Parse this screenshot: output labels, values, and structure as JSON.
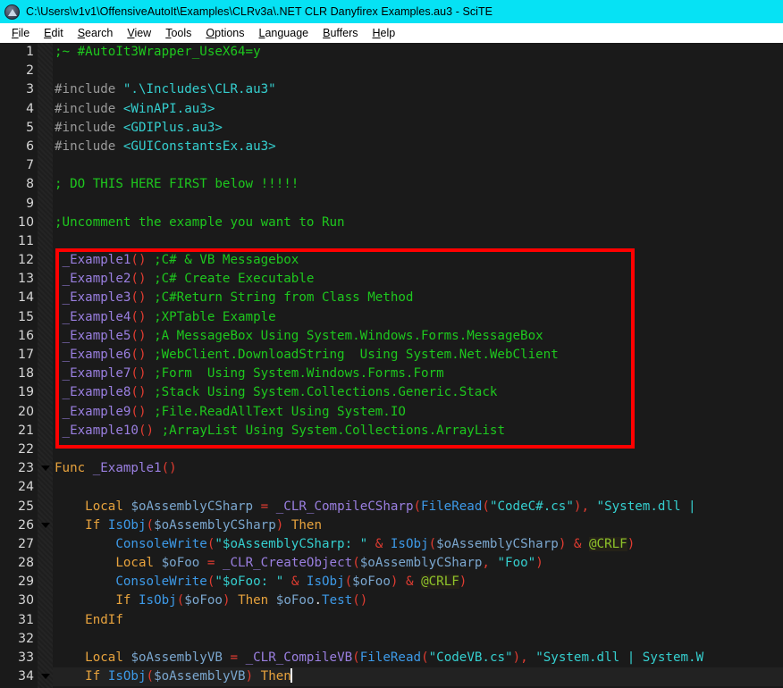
{
  "window": {
    "title": "C:\\Users\\v1v1\\OffensiveAutoIt\\Examples\\CLRv3a\\.NET CLR Danyfirex Examples.au3 - SciTE",
    "icon": "autoit-logo-icon",
    "titlebar_color": "#06e2f4",
    "menubar_color": "#ffffff"
  },
  "menu": {
    "items": [
      {
        "label": "File",
        "accel": "F"
      },
      {
        "label": "Edit",
        "accel": "E"
      },
      {
        "label": "Search",
        "accel": "S"
      },
      {
        "label": "View",
        "accel": "V"
      },
      {
        "label": "Tools",
        "accel": "T"
      },
      {
        "label": "Options",
        "accel": "O"
      },
      {
        "label": "Language",
        "accel": "L"
      },
      {
        "label": "Buffers",
        "accel": "B"
      },
      {
        "label": "Help",
        "accel": "H"
      }
    ]
  },
  "editor": {
    "background": "#1a1a1a",
    "first_line": 1,
    "last_line": 34,
    "current_line": 34,
    "caret_line": 34,
    "caret_column_text": "Then",
    "fold_lines": [
      23,
      26,
      34
    ],
    "annotation": {
      "type": "red-rectangle",
      "color": "#ff0000",
      "covers_lines": [
        12,
        21
      ]
    },
    "lines": [
      {
        "n": 1,
        "text": ";~ #AutoIt3Wrapper_UseX64=y"
      },
      {
        "n": 2,
        "text": ""
      },
      {
        "n": 3,
        "text": "#include \".\\Includes\\CLR.au3\""
      },
      {
        "n": 4,
        "text": "#include <WinAPI.au3>"
      },
      {
        "n": 5,
        "text": "#include <GDIPlus.au3>"
      },
      {
        "n": 6,
        "text": "#include <GUIConstantsEx.au3>"
      },
      {
        "n": 7,
        "text": ""
      },
      {
        "n": 8,
        "text": "; DO THIS HERE FIRST below !!!!!"
      },
      {
        "n": 9,
        "text": ""
      },
      {
        "n": 10,
        "text": ";Uncomment the example you want to Run"
      },
      {
        "n": 11,
        "text": ""
      },
      {
        "n": 12,
        "text": " _Example1() ;C# & VB Messagebox"
      },
      {
        "n": 13,
        "text": " _Example2() ;C# Create Executable"
      },
      {
        "n": 14,
        "text": " _Example3() ;C#Return String from Class Method"
      },
      {
        "n": 15,
        "text": " _Example4() ;XPTable Example"
      },
      {
        "n": 16,
        "text": " _Example5() ;A MessageBox Using System.Windows.Forms.MessageBox"
      },
      {
        "n": 17,
        "text": " _Example6() ;WebClient.DownloadString  Using System.Net.WebClient"
      },
      {
        "n": 18,
        "text": " _Example7() ;Form  Using System.Windows.Forms.Form"
      },
      {
        "n": 19,
        "text": " _Example8() ;Stack Using System.Collections.Generic.Stack"
      },
      {
        "n": 20,
        "text": " _Example9() ;File.ReadAllText Using System.IO"
      },
      {
        "n": 21,
        "text": " _Example10() ;ArrayList Using System.Collections.ArrayList"
      },
      {
        "n": 22,
        "text": ""
      },
      {
        "n": 23,
        "text": "Func _Example1()"
      },
      {
        "n": 24,
        "text": ""
      },
      {
        "n": 25,
        "text": "    Local $oAssemblyCSharp = _CLR_CompileCSharp(FileRead(\"CodeC#.cs\"), \"System.dll |"
      },
      {
        "n": 26,
        "text": "    If IsObj($oAssemblyCSharp) Then"
      },
      {
        "n": 27,
        "text": "        ConsoleWrite(\"$oAssemblyCSharp: \" & IsObj($oAssemblyCSharp) & @CRLF)"
      },
      {
        "n": 28,
        "text": "        Local $oFoo = _CLR_CreateObject($oAssemblyCSharp, \"Foo\")"
      },
      {
        "n": 29,
        "text": "        ConsoleWrite(\"$oFoo: \" & IsObj($oFoo) & @CRLF)"
      },
      {
        "n": 30,
        "text": "        If IsObj($oFoo) Then $oFoo.Test()"
      },
      {
        "n": 31,
        "text": "    EndIf"
      },
      {
        "n": 32,
        "text": ""
      },
      {
        "n": 33,
        "text": "    Local $oAssemblyVB = _CLR_CompileVB(FileRead(\"CodeVB.cs\"), \"System.dll | System.W"
      },
      {
        "n": 34,
        "text": "    If IsObj($oAssemblyVB) Then"
      }
    ]
  },
  "syntax_colors": {
    "comment": "#1ec81e",
    "preprocessor": "#9a9a9a",
    "preprocessor_string": "#35cfcf",
    "keyword": "#e8a33d",
    "builtin_function": "#3d9ae8",
    "user_function": "#9a7fe0",
    "variable": "#7ba7cf",
    "parenthesis": "#e03c31",
    "string": "#35cfcf",
    "macro": "#8fc42a"
  }
}
